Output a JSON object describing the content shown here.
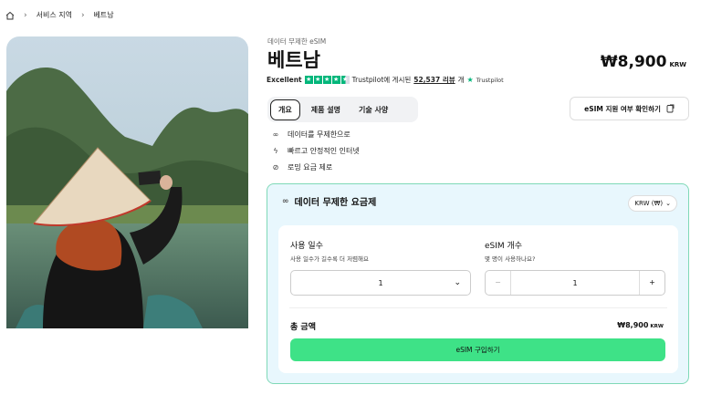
{
  "breadcrumb": {
    "items": [
      "서비스 지역",
      "베트남"
    ]
  },
  "product": {
    "subtitle": "데이터 무제한 eSIM",
    "title": "베트남",
    "price": "₩8,900",
    "price_currency": "KRW"
  },
  "rating": {
    "label": "Excellent",
    "text_before": "Trustpilot에 게시된",
    "reviews": "52,537 리뷰",
    "text_after": "개",
    "brand": "Trustpilot",
    "brand_color": "#00b67a"
  },
  "tabs": [
    {
      "label": "개요"
    },
    {
      "label": "제품 설명"
    },
    {
      "label": "기술 사양"
    }
  ],
  "check_button": {
    "label": "eSIM 지원 여부 확인하기",
    "icon": "external-check-icon"
  },
  "features": [
    {
      "icon": "infinity-icon",
      "label": "데이터를 무제한으로"
    },
    {
      "icon": "bolt-icon",
      "label": "빠르고 안정적인 인터넷"
    },
    {
      "icon": "no-roaming-icon",
      "label": "로밍 요금 제로"
    }
  ],
  "plan": {
    "title": "데이터 무제한 요금제",
    "currency_select": "KRW (₩)",
    "days": {
      "label": "사용 일수",
      "hint": "사용 일수가 길수록 더 저렴해요",
      "value": "1"
    },
    "esim_count": {
      "label": "eSIM 개수",
      "hint": "몇 명이 사용하나요?",
      "value": "1",
      "minus": "−",
      "plus": "+"
    },
    "total_label": "총 금액",
    "total_value": "₩8,900",
    "total_currency": "KRW",
    "buy_label": "eSIM 구입하기",
    "accent": "#3ee287"
  }
}
